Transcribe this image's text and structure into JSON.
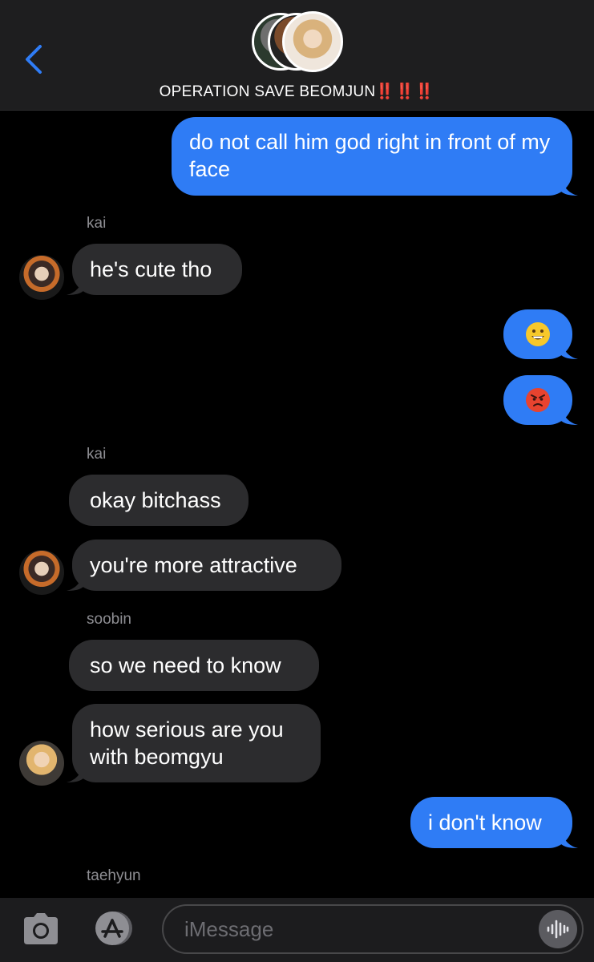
{
  "header": {
    "title": "OPERATION SAVE BEOMJUN",
    "title_emphasis": "‼️‼️‼️"
  },
  "messages": {
    "m1": "do not call him god right in front of my face",
    "kai_label_1": "kai",
    "m2": "he's cute tho",
    "m3_emoji": "😀",
    "m4_emoji": "😡",
    "kai_label_2": "kai",
    "m5": "okay bitchass",
    "m6": "you're more attractive",
    "soobin_label": "soobin",
    "m7": "so we need to know",
    "m8": "how serious are you with beomgyu",
    "m9": "i don't know",
    "taehyun_label": "taehyun"
  },
  "input": {
    "placeholder": "iMessage"
  },
  "colors": {
    "outgoing_bubble": "#2f7cf5",
    "incoming_bubble": "#2c2c2e",
    "accent": "#2f7cf5",
    "emphasis_red": "#e8303a"
  },
  "icons": [
    "back-chevron-icon",
    "camera-icon",
    "app-store-icon",
    "audio-waveform-icon"
  ]
}
